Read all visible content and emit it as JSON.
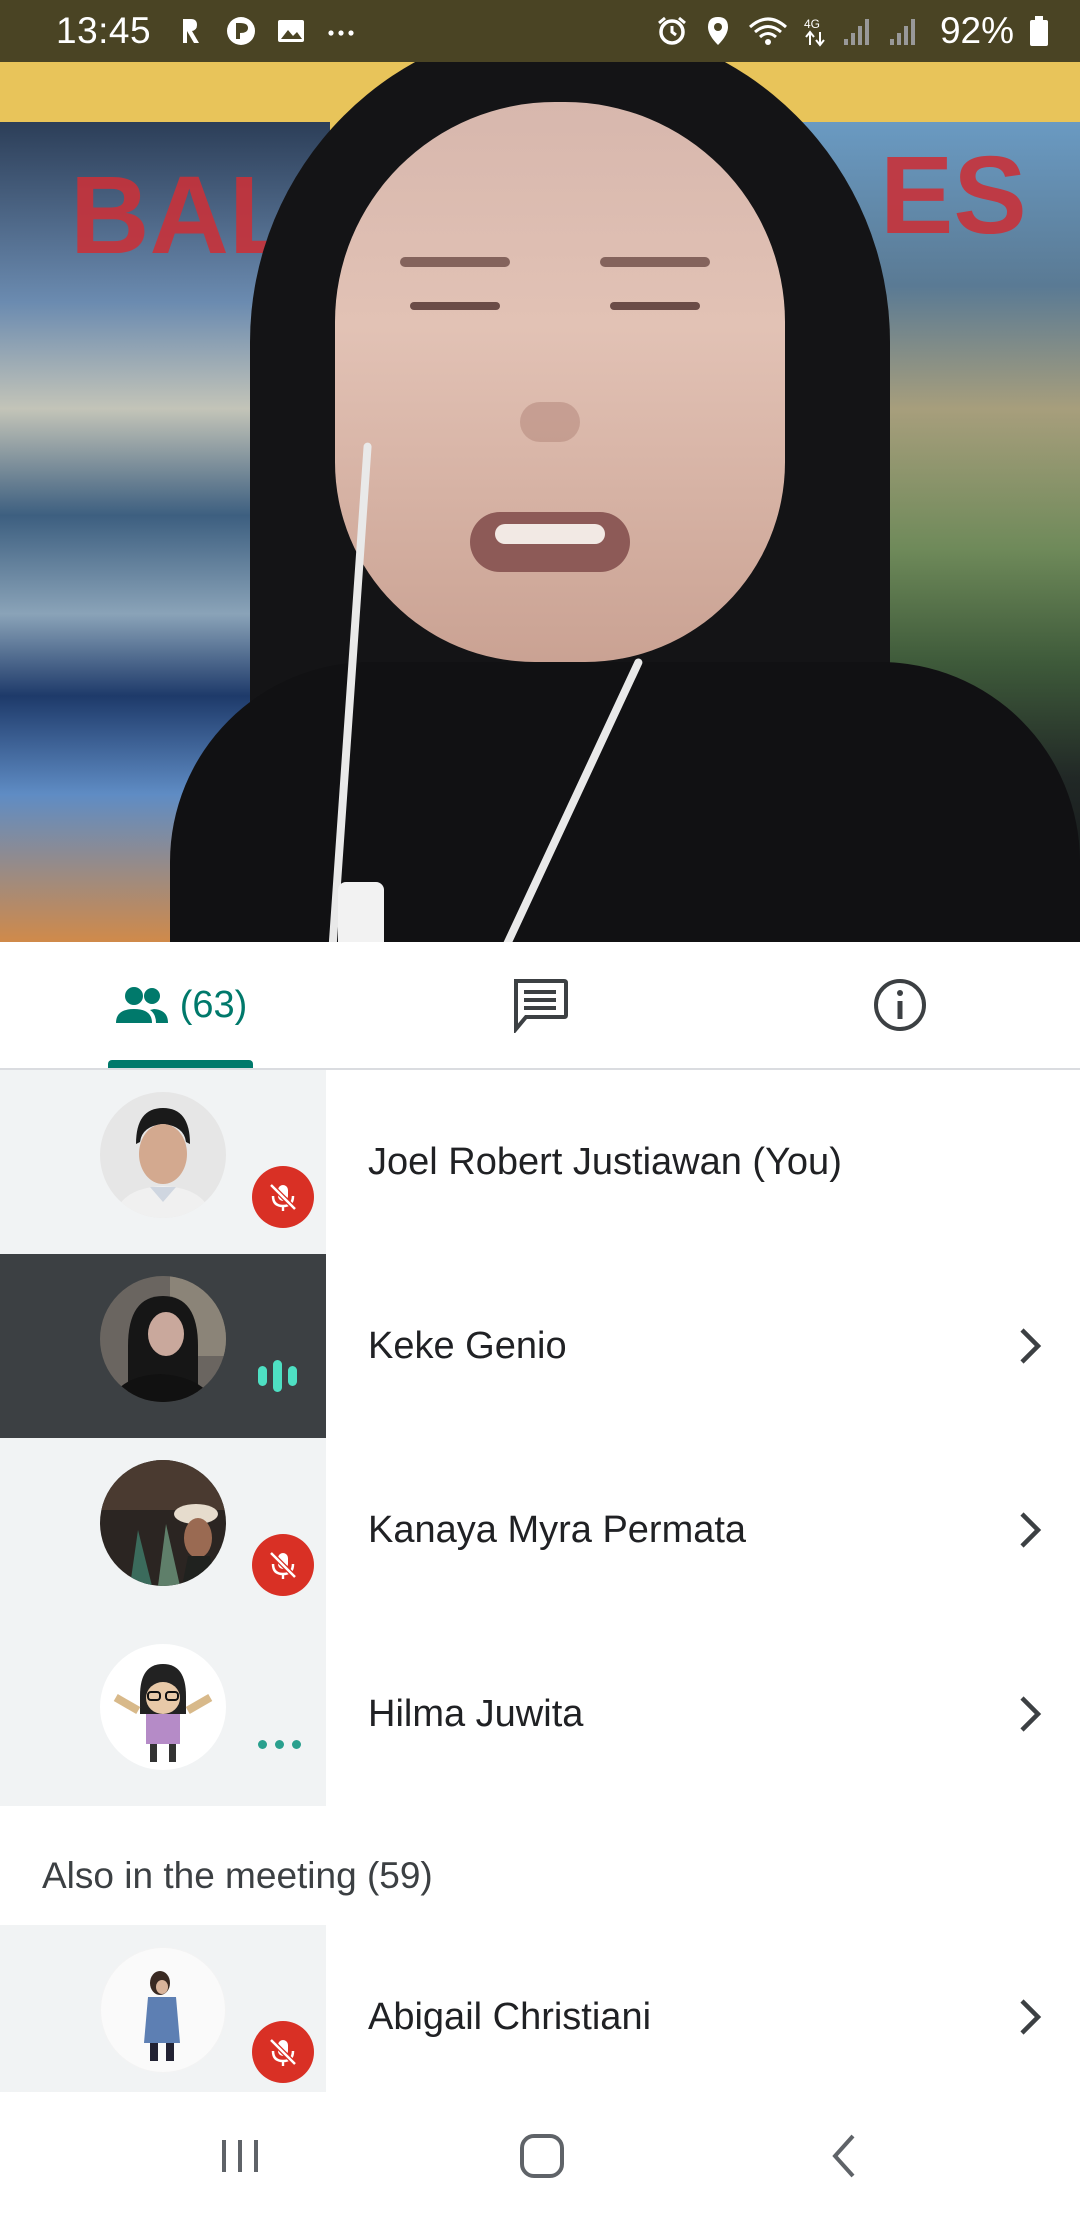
{
  "status_bar": {
    "time": "13:45",
    "left_icons": [
      "autofill-icon",
      "phone-icon",
      "image-icon",
      "more-icon"
    ],
    "right_icons": [
      "alarm-icon",
      "location-icon",
      "wifi-icon",
      "4g-icon",
      "signal-icon",
      "signal-icon"
    ],
    "network": "4G",
    "battery": "92%"
  },
  "video": {
    "backdrop_text_left": "BAL",
    "backdrop_text_right": "ES"
  },
  "tabs": {
    "people_count": "(63)",
    "active": "people"
  },
  "participants": [
    {
      "name": "Joel Robert Justiawan (You)",
      "status": "muted",
      "has_chevron": false
    },
    {
      "name": "Keke Genio",
      "status": "speaking",
      "has_chevron": true
    },
    {
      "name": "Kanaya Myra Permata",
      "status": "muted",
      "has_chevron": true
    },
    {
      "name": "Hilma Juwita",
      "status": "connecting",
      "has_chevron": true
    }
  ],
  "also_header": "Also in the meeting (59)",
  "also_participants": [
    {
      "name": "Abigail Christiani",
      "status": "muted",
      "has_chevron": true
    }
  ],
  "colors": {
    "accent": "#00796b",
    "mute_red": "#d93025",
    "speaking_teal": "#4ee0c3",
    "status_bar_bg": "#4a4424"
  }
}
